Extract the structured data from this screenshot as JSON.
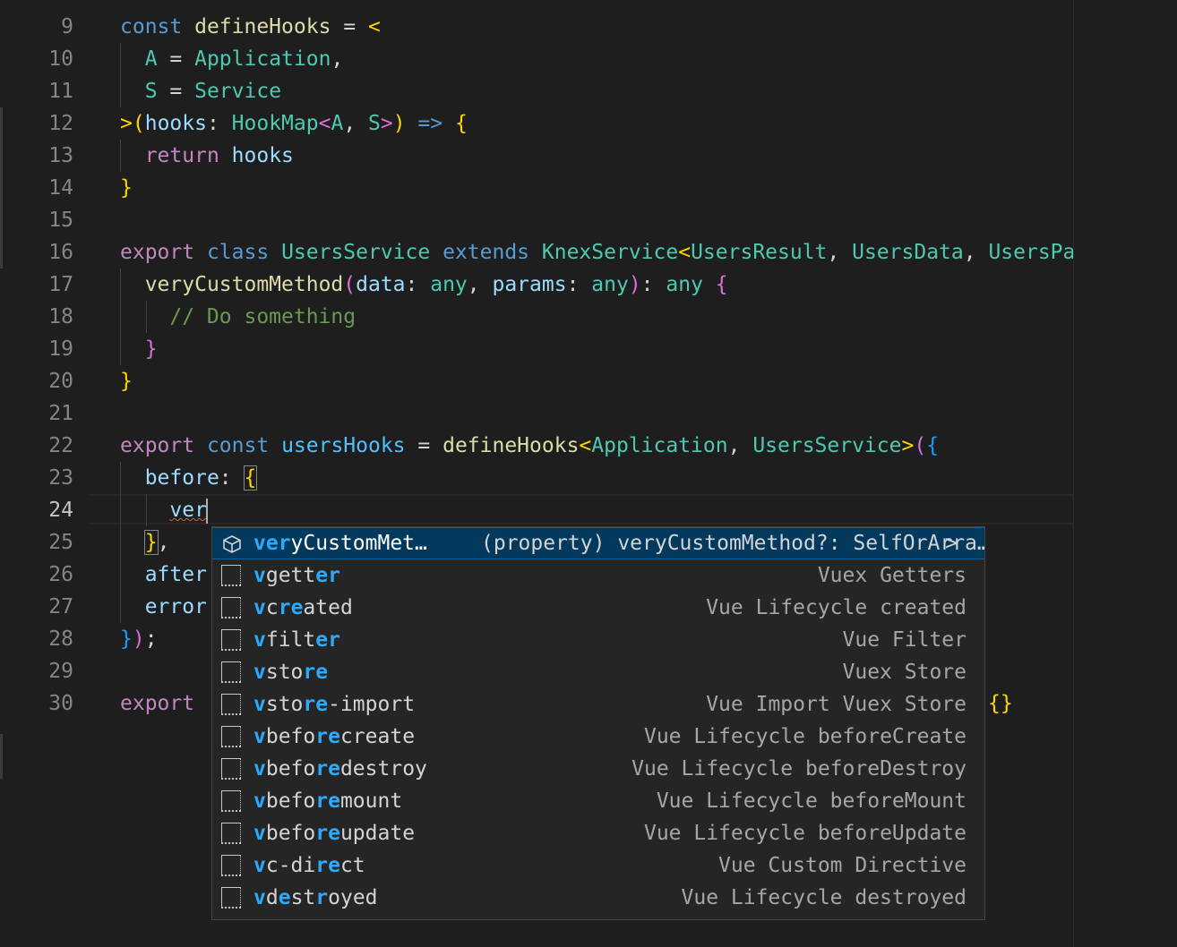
{
  "editor": {
    "active_line": 24,
    "lines": [
      {
        "n": "9",
        "tokens": [
          [
            "kw",
            "const "
          ],
          [
            "fn",
            "defineHooks"
          ],
          [
            "op",
            " = "
          ],
          [
            "br1",
            "<"
          ]
        ]
      },
      {
        "n": "10",
        "tokens": [
          [
            "op",
            "  "
          ],
          [
            "ty",
            "A"
          ],
          [
            "op",
            " = "
          ],
          [
            "ty",
            "Application"
          ],
          [
            "op",
            ","
          ]
        ]
      },
      {
        "n": "11",
        "tokens": [
          [
            "op",
            "  "
          ],
          [
            "ty",
            "S"
          ],
          [
            "op",
            " = "
          ],
          [
            "ty",
            "Service"
          ]
        ]
      },
      {
        "n": "12",
        "tokens": [
          [
            "br1",
            ">"
          ],
          [
            "br1",
            "("
          ],
          [
            "var",
            "hooks"
          ],
          [
            "op",
            ": "
          ],
          [
            "ty",
            "HookMap"
          ],
          [
            "br2",
            "<"
          ],
          [
            "ty",
            "A"
          ],
          [
            "op",
            ", "
          ],
          [
            "ty",
            "S"
          ],
          [
            "br2",
            ">"
          ],
          [
            "br1",
            ")"
          ],
          [
            "kw",
            " =>"
          ],
          [
            "op",
            " "
          ],
          [
            "br1",
            "{"
          ]
        ]
      },
      {
        "n": "13",
        "tokens": [
          [
            "op",
            "  "
          ],
          [
            "kw2",
            "return"
          ],
          [
            "op",
            " "
          ],
          [
            "var",
            "hooks"
          ]
        ]
      },
      {
        "n": "14",
        "tokens": [
          [
            "br1",
            "}"
          ]
        ]
      },
      {
        "n": "15",
        "tokens": []
      },
      {
        "n": "16",
        "tokens": [
          [
            "kw2",
            "export"
          ],
          [
            "op",
            " "
          ],
          [
            "kw",
            "class"
          ],
          [
            "op",
            " "
          ],
          [
            "ty",
            "UsersService"
          ],
          [
            "op",
            " "
          ],
          [
            "kw",
            "extends"
          ],
          [
            "op",
            " "
          ],
          [
            "ty",
            "KnexService"
          ],
          [
            "br1",
            "<"
          ],
          [
            "ty",
            "UsersResult"
          ],
          [
            "op",
            ", "
          ],
          [
            "ty",
            "UsersData"
          ],
          [
            "op",
            ", "
          ],
          [
            "ty",
            "UsersParams"
          ]
        ]
      },
      {
        "n": "17",
        "tokens": [
          [
            "op",
            "  "
          ],
          [
            "fn",
            "veryCustomMethod"
          ],
          [
            "br2",
            "("
          ],
          [
            "var",
            "data"
          ],
          [
            "op",
            ": "
          ],
          [
            "ty",
            "any"
          ],
          [
            "op",
            ", "
          ],
          [
            "var",
            "params"
          ],
          [
            "op",
            ": "
          ],
          [
            "ty",
            "any"
          ],
          [
            "br2",
            ")"
          ],
          [
            "op",
            ": "
          ],
          [
            "ty",
            "any"
          ],
          [
            "op",
            " "
          ],
          [
            "br2",
            "{"
          ]
        ]
      },
      {
        "n": "18",
        "tokens": [
          [
            "op",
            "    "
          ],
          [
            "cmt",
            "// Do something"
          ]
        ]
      },
      {
        "n": "19",
        "tokens": [
          [
            "op",
            "  "
          ],
          [
            "br2",
            "}"
          ]
        ]
      },
      {
        "n": "20",
        "tokens": [
          [
            "br1",
            "}"
          ]
        ]
      },
      {
        "n": "21",
        "tokens": []
      },
      {
        "n": "22",
        "tokens": [
          [
            "kw2",
            "export"
          ],
          [
            "op",
            " "
          ],
          [
            "kw",
            "const"
          ],
          [
            "op",
            " "
          ],
          [
            "cvar",
            "usersHooks"
          ],
          [
            "op",
            " = "
          ],
          [
            "fn",
            "defineHooks"
          ],
          [
            "br1",
            "<"
          ],
          [
            "ty",
            "Application"
          ],
          [
            "op",
            ", "
          ],
          [
            "ty",
            "UsersService"
          ],
          [
            "br1",
            ">"
          ],
          [
            "br2",
            "("
          ],
          [
            "br3",
            "{"
          ]
        ]
      },
      {
        "n": "23",
        "tokens": [
          [
            "op",
            "  "
          ],
          [
            "var",
            "before"
          ],
          [
            "op",
            ": "
          ],
          [
            "br1",
            "{"
          ]
        ]
      },
      {
        "n": "24",
        "tokens": [
          [
            "op",
            "    "
          ],
          [
            "var",
            "ver"
          ]
        ]
      },
      {
        "n": "25",
        "tokens": [
          [
            "op",
            "  "
          ],
          [
            "br1",
            "}"
          ],
          [
            "op",
            ","
          ]
        ]
      },
      {
        "n": "26",
        "tokens": [
          [
            "op",
            "  "
          ],
          [
            "var",
            "after"
          ]
        ]
      },
      {
        "n": "27",
        "tokens": [
          [
            "op",
            "  "
          ],
          [
            "var",
            "error"
          ]
        ]
      },
      {
        "n": "28",
        "tokens": [
          [
            "br3",
            "}"
          ],
          [
            "br2",
            ")"
          ],
          [
            "op",
            ";"
          ]
        ]
      },
      {
        "n": "29",
        "tokens": []
      },
      {
        "n": "30",
        "tokens": [
          [
            "kw2",
            "export"
          ]
        ]
      }
    ],
    "line30_tail": "{}"
  },
  "suggest": {
    "items": [
      {
        "label_match": "ver",
        "label_rest": "yCustomMet…",
        "detail": "(property) veryCustomMethod?: SelfOrArra…",
        "icon": "property-cube-icon",
        "selected": true
      },
      {
        "parts": [
          [
            "m",
            "v"
          ],
          [
            "n",
            "gett"
          ],
          [
            "m",
            "er"
          ]
        ],
        "detail": "Vuex Getters",
        "icon": "snippet-icon"
      },
      {
        "parts": [
          [
            "m",
            "v"
          ],
          [
            "n",
            "c"
          ],
          [
            "m",
            "re"
          ],
          [
            "n",
            "ated"
          ]
        ],
        "detail": "Vue Lifecycle created",
        "icon": "snippet-icon"
      },
      {
        "parts": [
          [
            "m",
            "v"
          ],
          [
            "n",
            "filt"
          ],
          [
            "m",
            "er"
          ]
        ],
        "detail": "Vue Filter",
        "icon": "snippet-icon"
      },
      {
        "parts": [
          [
            "m",
            "v"
          ],
          [
            "n",
            "sto"
          ],
          [
            "m",
            "re"
          ]
        ],
        "detail": "Vuex Store",
        "icon": "snippet-icon"
      },
      {
        "parts": [
          [
            "m",
            "v"
          ],
          [
            "n",
            "sto"
          ],
          [
            "m",
            "re"
          ],
          [
            "n",
            "-import"
          ]
        ],
        "detail": "Vue Import Vuex Store",
        "icon": "snippet-icon"
      },
      {
        "parts": [
          [
            "m",
            "v"
          ],
          [
            "n",
            "befo"
          ],
          [
            "m",
            "re"
          ],
          [
            "n",
            "create"
          ]
        ],
        "detail": "Vue Lifecycle beforeCreate",
        "icon": "snippet-icon"
      },
      {
        "parts": [
          [
            "m",
            "v"
          ],
          [
            "n",
            "befo"
          ],
          [
            "m",
            "re"
          ],
          [
            "n",
            "destroy"
          ]
        ],
        "detail": "Vue Lifecycle beforeDestroy",
        "icon": "snippet-icon"
      },
      {
        "parts": [
          [
            "m",
            "v"
          ],
          [
            "n",
            "befo"
          ],
          [
            "m",
            "re"
          ],
          [
            "n",
            "mount"
          ]
        ],
        "detail": "Vue Lifecycle beforeMount",
        "icon": "snippet-icon"
      },
      {
        "parts": [
          [
            "m",
            "v"
          ],
          [
            "n",
            "befo"
          ],
          [
            "m",
            "re"
          ],
          [
            "n",
            "update"
          ]
        ],
        "detail": "Vue Lifecycle beforeUpdate",
        "icon": "snippet-icon"
      },
      {
        "parts": [
          [
            "m",
            "v"
          ],
          [
            "n",
            "c-di"
          ],
          [
            "m",
            "re"
          ],
          [
            "n",
            "ct"
          ]
        ],
        "detail": "Vue Custom Directive",
        "icon": "snippet-icon"
      },
      {
        "parts": [
          [
            "m",
            "v"
          ],
          [
            "n",
            "d"
          ],
          [
            "m",
            "e"
          ],
          [
            "n",
            "st"
          ],
          [
            "m",
            "r"
          ],
          [
            "n",
            "oyed"
          ]
        ],
        "detail": "Vue Lifecycle destroyed",
        "icon": "snippet-icon"
      }
    ],
    "chevron": ">"
  },
  "colors": {
    "background": "#1e1e1e",
    "selection": "#04395e",
    "match": "#2aaaff"
  }
}
